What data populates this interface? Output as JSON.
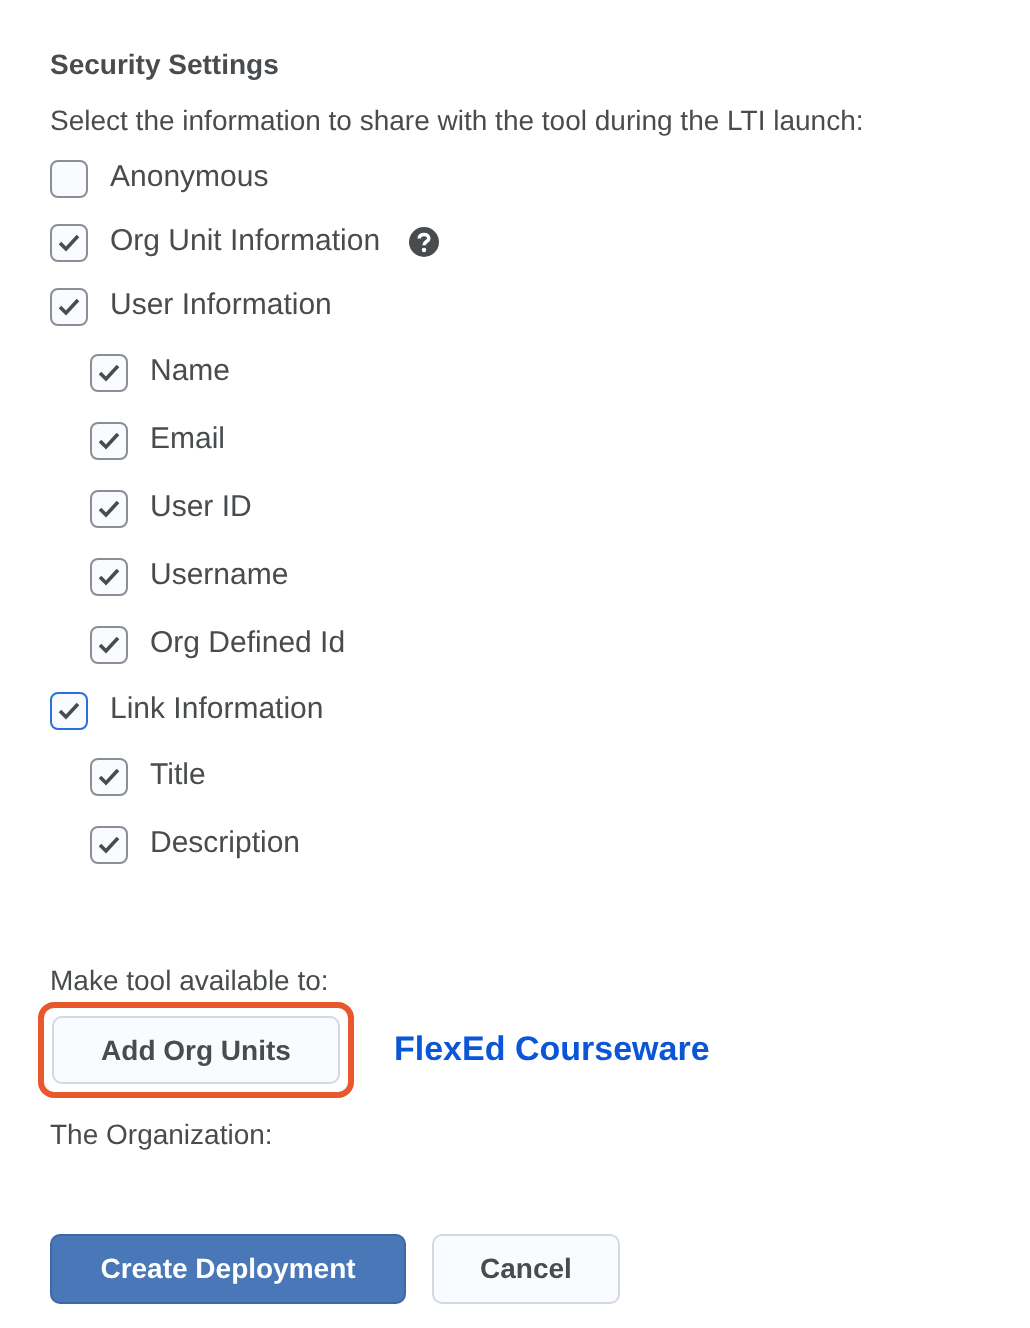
{
  "section_title": "Security Settings",
  "instructions": "Select the information to share with the tool during the LTI launch:",
  "options": [
    {
      "label": "Anonymous",
      "checked": false
    },
    {
      "label": "Org Unit Information",
      "checked": true,
      "help": true
    },
    {
      "label": "User Information",
      "checked": true,
      "children": [
        {
          "label": "Name",
          "checked": true
        },
        {
          "label": "Email",
          "checked": true
        },
        {
          "label": "User ID",
          "checked": true
        },
        {
          "label": "Username",
          "checked": true
        },
        {
          "label": "Org Defined Id",
          "checked": true
        }
      ]
    },
    {
      "label": "Link Information",
      "checked": true,
      "focused": true,
      "children": [
        {
          "label": "Title",
          "checked": true
        },
        {
          "label": "Description",
          "checked": true
        }
      ]
    }
  ],
  "availability_label": "Make tool available to:",
  "add_button": {
    "label": "Add Org Units",
    "highlighted": true
  },
  "annotation": "FlexEd Courseware",
  "organization_label": "The Organization:",
  "buttons": [
    {
      "label": "Create Deployment",
      "kind": "primary"
    },
    {
      "label": "Cancel",
      "kind": "secondary"
    }
  ]
}
